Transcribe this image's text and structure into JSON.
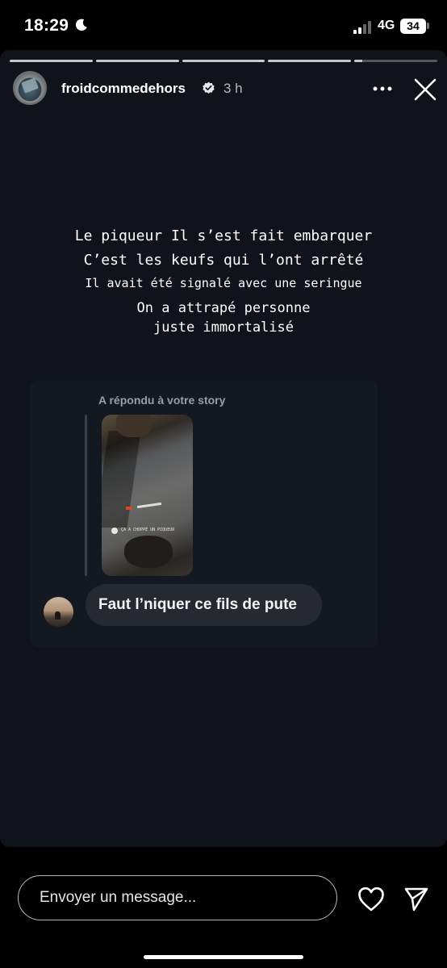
{
  "status_bar": {
    "time": "18:29",
    "network": "4G",
    "battery": "34"
  },
  "story": {
    "progress": [
      1,
      1,
      1,
      1,
      0.1
    ],
    "username": "froidcommedehors",
    "time_ago": "3 h",
    "caption_lines": [
      "Le piqueur Il s’est fait embarquer",
      "C’est les keufs qui l’ont arrêté",
      "Il avait été signalé avec une seringue",
      "On a attrapé personne",
      "juste immortalisé"
    ]
  },
  "reply": {
    "label": "A répondu à votre story",
    "thumbnail_caption": "ÇA A CHOPPÉ UN PIQUEUR",
    "message": "Faut l’niquer ce fils de pute"
  },
  "footer": {
    "input_placeholder": "Envoyer un message..."
  },
  "icons": {
    "moon": "moon-icon",
    "signal": "signal-icon",
    "verified": "verified-icon",
    "more": "more-icon",
    "close": "close-icon",
    "heart": "heart-icon",
    "send": "send-icon"
  }
}
